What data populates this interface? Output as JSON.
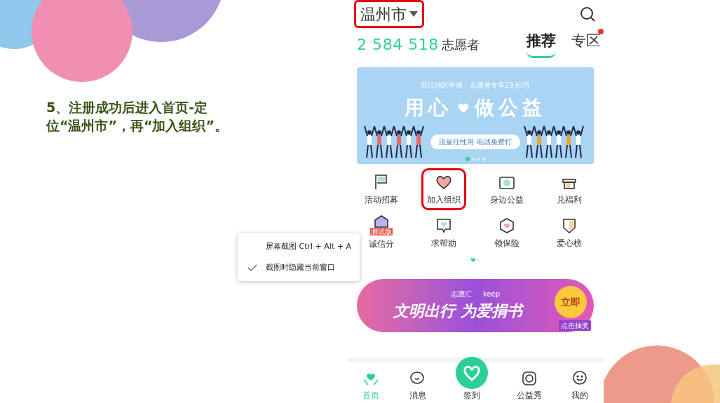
{
  "instruction": {
    "number": "5、",
    "text": "注册成功后进入首页-定位“温州市”，再“加入组织”。"
  },
  "app": {
    "header": {
      "city": "温州市",
      "highlighted": true
    },
    "stats": {
      "count": "2 584 518",
      "unit": "志愿者"
    },
    "tabs": [
      {
        "label": "推荐",
        "selected": true,
        "dot": false
      },
      {
        "label": "专区",
        "selected": false,
        "dot": true
      }
    ],
    "banner": {
      "subtitle": "浙江地区申领，志愿者专享29元/月",
      "title_left": "用心",
      "title_right": "做公益",
      "pill": "流量任性用·电话免费打"
    },
    "grid": [
      {
        "label": "活动招募",
        "highlighted": false
      },
      {
        "label": "加入组织",
        "highlighted": true
      },
      {
        "label": "身边公益",
        "highlighted": false
      },
      {
        "label": "兑福利",
        "highlighted": false
      },
      {
        "label": "诚信分",
        "highlighted": false,
        "badge": "测试版"
      },
      {
        "label": "求帮助",
        "highlighted": false
      },
      {
        "label": "领保险",
        "highlighted": false
      },
      {
        "label": "爱心榜",
        "highlighted": false
      }
    ],
    "promo": {
      "logo_left": "志愿汇",
      "logo_right": "keep",
      "title": "文明出行 为爱捐书",
      "button": "立即",
      "lottery": "点击抽奖"
    },
    "nav": [
      {
        "label": "首页",
        "kind": "tab",
        "selected": true
      },
      {
        "label": "消息",
        "kind": "tab",
        "selected": false
      },
      {
        "label": "签到",
        "kind": "center",
        "selected": false
      },
      {
        "label": "公益秀",
        "kind": "tab",
        "selected": false
      },
      {
        "label": "我的",
        "kind": "tab",
        "selected": false
      }
    ]
  },
  "context_menu": [
    {
      "label": "屏幕截图 Ctrl + Alt + A",
      "checked": false
    },
    {
      "label": "截图时隐藏当前窗口",
      "checked": true
    }
  ]
}
